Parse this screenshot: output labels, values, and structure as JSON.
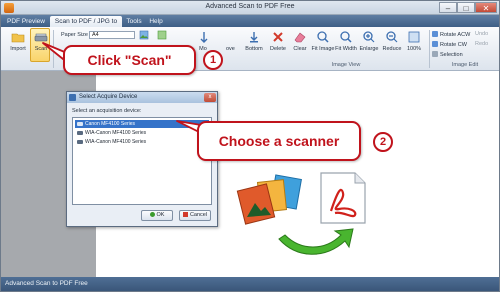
{
  "window": {
    "title": "Advanced Scan to PDF Free"
  },
  "window_controls": {
    "minimize": "–",
    "maximize": "□",
    "close": "✕"
  },
  "tabs": [
    {
      "label": "PDF Preview"
    },
    {
      "label": "Scan to PDF / JPG to PDF"
    },
    {
      "label": "Tools"
    },
    {
      "label": "Help"
    }
  ],
  "toolbar": {
    "import_label": "Import",
    "scan_label": "Scan",
    "paper_size_label": "Paper Size",
    "paper_size_value": "A4",
    "move_label": "Mo",
    "move_label_2": "ove",
    "bottom_label": "Bottom",
    "delete_label": "Delete",
    "clear_label": "Clear",
    "fit_image_label": "Fit Image",
    "fit_width_label": "Fit Width",
    "enlarge_label": "Enlarge",
    "reduce_label": "Reduce",
    "zoom_100_label": "100%",
    "rotate_acw_label": "Rotate ACW",
    "rotate_cw_label": "Rotate CW",
    "selection_label": "Selection",
    "undo_label": "Undo",
    "redo_label": "Redo",
    "image_view_group": "Image View",
    "image_edit_group": "Image Edit"
  },
  "dialog": {
    "title": "Select Acquire Device",
    "prompt": "Select an acquisition device:",
    "devices": [
      {
        "label": "Canon MF4100 Series"
      },
      {
        "label": "WIA-Canon MF4100 Series"
      },
      {
        "label": "WIA-Canon MF4100 Series"
      }
    ],
    "ok_label": "OK",
    "cancel_label": "Cancel",
    "close": "x"
  },
  "annotations": {
    "callout_1": "Click \"Scan\"",
    "badge_1": "1",
    "callout_2": "Choose a scanner",
    "badge_2": "2"
  },
  "status": {
    "text": "Advanced Scan to PDF Free"
  },
  "colors": {
    "accent_red": "#c0131c",
    "selection_blue": "#3573c9",
    "tab_bar": "#4a6a90"
  }
}
